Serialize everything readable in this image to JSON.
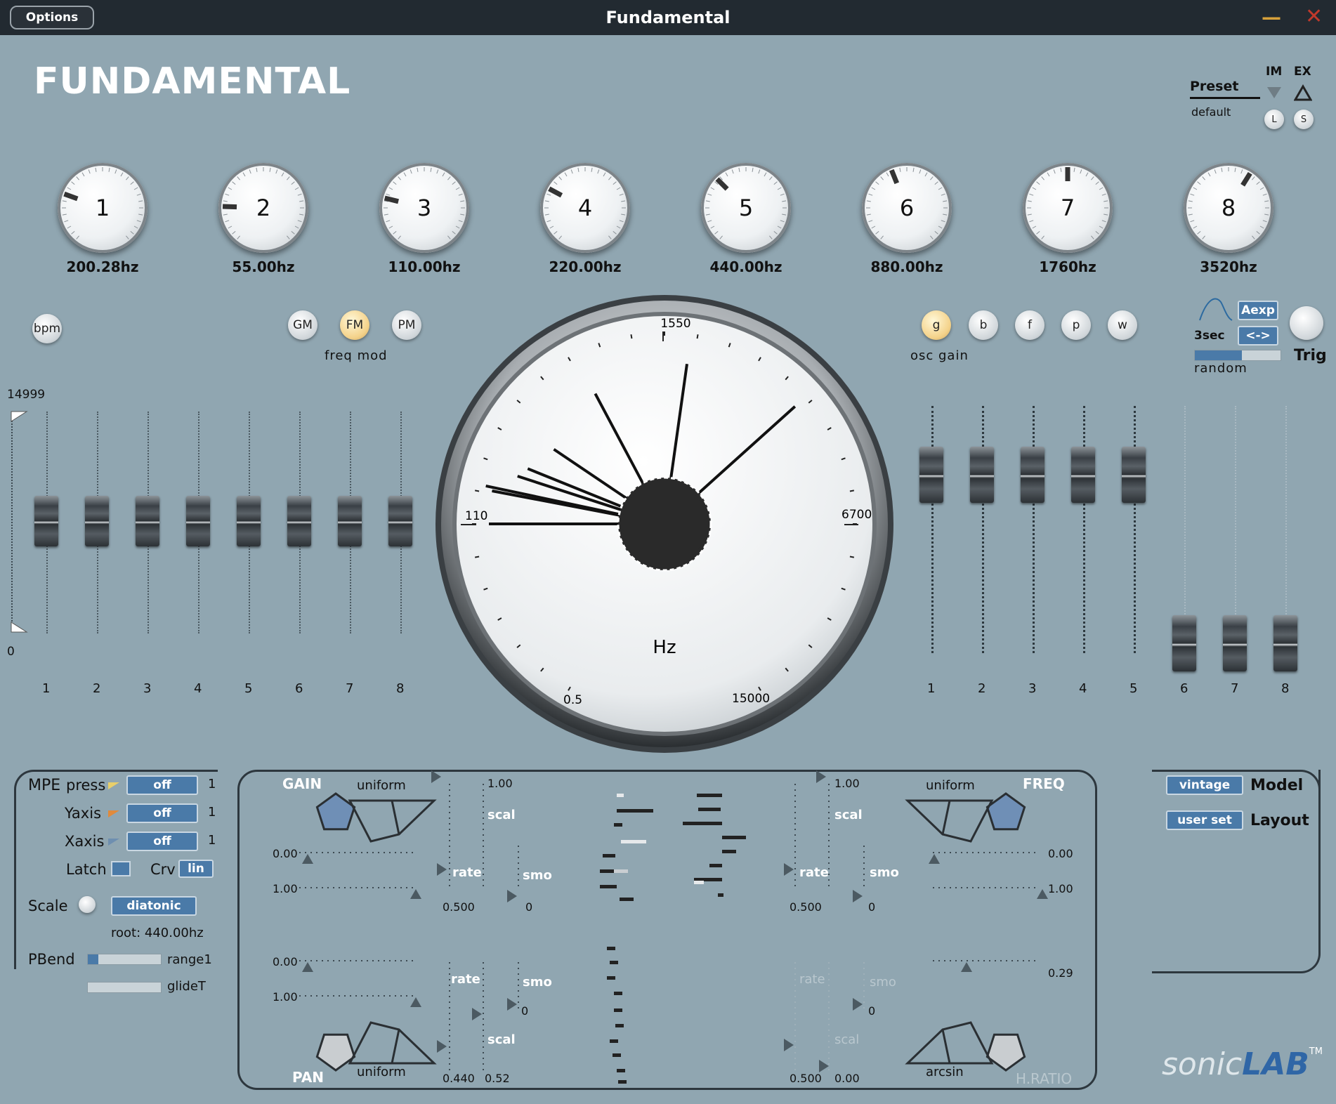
{
  "window": {
    "title": "Fundamental",
    "options_label": "Options",
    "minimize": "—",
    "close": "✕"
  },
  "brand": "FUNDAMENTAL",
  "preset": {
    "label": "Preset",
    "value": "default",
    "im": "IM",
    "ex": "EX",
    "load": "L",
    "save": "S"
  },
  "oscillators": [
    {
      "num": "1",
      "freq": "200.28hz",
      "angle": -70
    },
    {
      "num": "2",
      "freq": "55.00hz",
      "angle": -88
    },
    {
      "num": "3",
      "freq": "110.00hz",
      "angle": -76
    },
    {
      "num": "4",
      "freq": "220.00hz",
      "angle": -62
    },
    {
      "num": "5",
      "freq": "440.00hz",
      "angle": -45
    },
    {
      "num": "6",
      "freq": "880.00hz",
      "angle": -22
    },
    {
      "num": "7",
      "freq": "1760hz",
      "angle": 0
    },
    {
      "num": "8",
      "freq": "3520hz",
      "angle": 32
    }
  ],
  "buttons": {
    "bpm": "bpm",
    "gm": "GM",
    "fm": "FM",
    "pm": "PM",
    "freq_mod": "freq mod",
    "g": "g",
    "b": "b",
    "f": "f",
    "p": "p",
    "w": "w",
    "osc_gain": "osc gain"
  },
  "envelope": {
    "time": "3sec",
    "mode": "Aexp",
    "dir": "<->",
    "random": "random",
    "random_level": 0.55,
    "trig": "Trig"
  },
  "left_faders": {
    "max": "14999",
    "min": "0",
    "labels": [
      "1",
      "2",
      "3",
      "4",
      "5",
      "6",
      "7",
      "8"
    ]
  },
  "right_faders": {
    "labels": [
      "1",
      "2",
      "3",
      "4",
      "5",
      "6",
      "7",
      "8"
    ]
  },
  "dial": {
    "unit": "Hz",
    "labels": {
      "top": "1550",
      "left": "110",
      "right": "6700",
      "bottom_left": "0.5",
      "bottom_right": "15000"
    }
  },
  "mpe": {
    "title": "MPE",
    "press": "press",
    "yaxis": "Yaxis",
    "xaxis": "Xaxis",
    "press_val": "off",
    "yaxis_val": "off",
    "xaxis_val": "off",
    "press_n": "1",
    "yaxis_n": "1",
    "xaxis_n": "1",
    "latch": "Latch",
    "crv": "Crv",
    "crv_val": "lin",
    "scale": "Scale",
    "scale_val": "diatonic",
    "root": "root: 440.00hz",
    "pbend": "PBend",
    "range": "range1",
    "glide": "glideT"
  },
  "mod": {
    "gain": "GAIN",
    "freq": "FREQ",
    "pan": "PAN",
    "hratio": "H.RATIO",
    "uniform1": "uniform",
    "uniform2": "uniform",
    "uniform3": "uniform",
    "arcsin": "arcsin",
    "g_min": "0.00",
    "g_max": "1.00",
    "g_scal_v": "1.00",
    "g_scal": "scal",
    "g_rate": "rate",
    "g_smo": "smo",
    "g_rate_v": "0.500",
    "g_smo_v": "0",
    "f_min": "0.00",
    "f_max": "1.00",
    "f_scal_v": "1.00",
    "f_scal": "scal",
    "f_rate": "rate",
    "f_smo": "smo",
    "f_rate_v": "0.500",
    "f_smo_v": "0",
    "p_min": "0.00",
    "p_max": "1.00",
    "p_rate": "rate",
    "p_smo": "smo",
    "p_smo_v": "0",
    "p_scal": "scal",
    "p_rate_v": "0.440",
    "p_scal_v": "0.52",
    "h_val": "0.29",
    "h_rate": "rate",
    "h_smo": "smo",
    "h_smo_v": "0",
    "h_scal": "scal",
    "h_rate_v": "0.500",
    "h_scal_v": "0.00"
  },
  "model": {
    "model_val": "vintage",
    "model_label": "Model",
    "layout_val": "user set",
    "layout_label": "Layout"
  },
  "logo": {
    "a": "sonic",
    "b": "LAB",
    "tm": "TM"
  }
}
